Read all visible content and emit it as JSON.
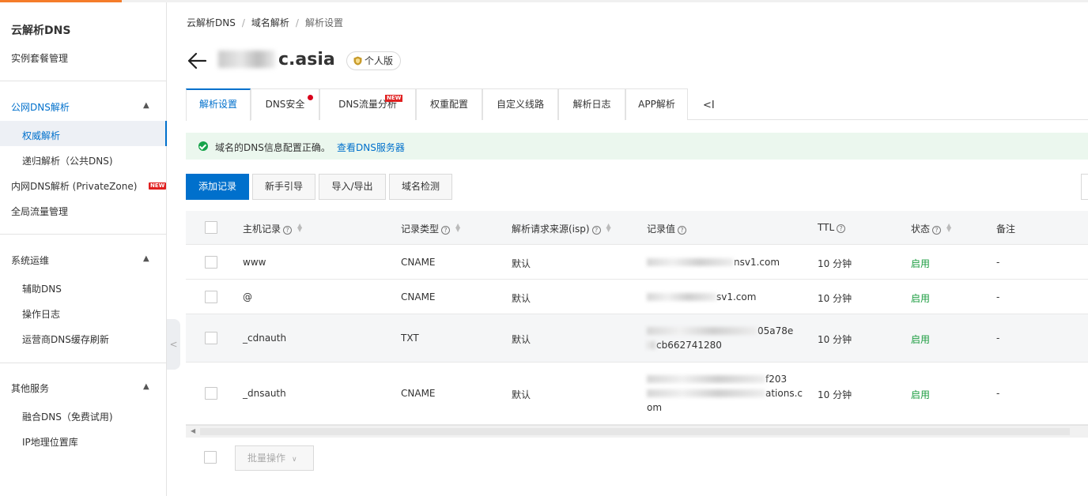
{
  "colors": {
    "accent": "#0070cc",
    "active_tab_bg": "#edf0f5",
    "success": "#1a9c3f",
    "alert_bg": "#ebf7ee",
    "new_badge": "#e02020",
    "brand_orange": "#f57c2a"
  },
  "sidebar": {
    "title": "云解析DNS",
    "instance": "实例套餐管理",
    "public_dns": {
      "label": "公网DNS解析",
      "items": [
        {
          "label": "权威解析",
          "active": true
        },
        {
          "label": "递归解析（公共DNS)"
        }
      ]
    },
    "private_dns": {
      "label": "内网DNS解析 (PrivateZone)",
      "badge": "NEW"
    },
    "global_traffic": "全局流量管理",
    "ops": {
      "label": "系统运维",
      "items": [
        {
          "label": "辅助DNS"
        },
        {
          "label": "操作日志"
        },
        {
          "label": "运营商DNS缓存刷新"
        }
      ]
    },
    "other": {
      "label": "其他服务",
      "items": [
        {
          "label": "融合DNS（免费试用)"
        },
        {
          "label": "IP地理位置库"
        }
      ]
    },
    "caret_icon": "chevron-up-icon"
  },
  "breadcrumb": {
    "items": [
      "云解析DNS",
      "域名解析",
      "解析设置"
    ],
    "separator": "/"
  },
  "header": {
    "domain": "c.asia",
    "plan": "个人版",
    "back_icon": "arrow-left-icon",
    "plan_icon": "shield-icon"
  },
  "tabs": [
    {
      "label": "解析设置",
      "active": true
    },
    {
      "label": "DNS安全",
      "dot": true
    },
    {
      "label": "DNS流量分析",
      "badge": "NEW"
    },
    {
      "label": "权重配置"
    },
    {
      "label": "自定义线路"
    },
    {
      "label": "解析日志"
    },
    {
      "label": "APP解析"
    }
  ],
  "tab_scroll_icon": "<I",
  "alert": {
    "message": "域名的DNS信息配置正确。",
    "link": "查看DNS服务器",
    "icon": "check-circle-icon"
  },
  "toolbar": {
    "add": "添加记录",
    "guide": "新手引导",
    "import_export": "导入/导出",
    "check": "域名检测"
  },
  "table": {
    "columns": {
      "host": "主机记录",
      "type": "记录类型",
      "line": "解析请求来源(isp)",
      "value": "记录值",
      "ttl": "TTL",
      "status": "状态",
      "remark": "备注"
    },
    "rows": [
      {
        "host": "www",
        "type": "CNAME",
        "line": "默认",
        "value": [
          "nsv1.com"
        ],
        "ttl": "10 分钟",
        "status": "启用",
        "remark": "-"
      },
      {
        "host": "@",
        "type": "CNAME",
        "line": "默认",
        "value": [
          "sv1.com"
        ],
        "ttl": "10 分钟",
        "status": "启用",
        "remark": "-"
      },
      {
        "host": "_cdnauth",
        "type": "TXT",
        "line": "默认",
        "value": [
          "05a78e",
          "cb662741280"
        ],
        "ttl": "10 分钟",
        "status": "启用",
        "remark": "-"
      },
      {
        "host": "_dnsauth",
        "type": "CNAME",
        "line": "默认",
        "value": [
          "f203",
          "ations.c",
          "om"
        ],
        "ttl": "10 分钟",
        "status": "启用",
        "remark": "-"
      }
    ]
  },
  "footer": {
    "batch": "批量操作",
    "batch_icon": "chevron-down-icon"
  }
}
